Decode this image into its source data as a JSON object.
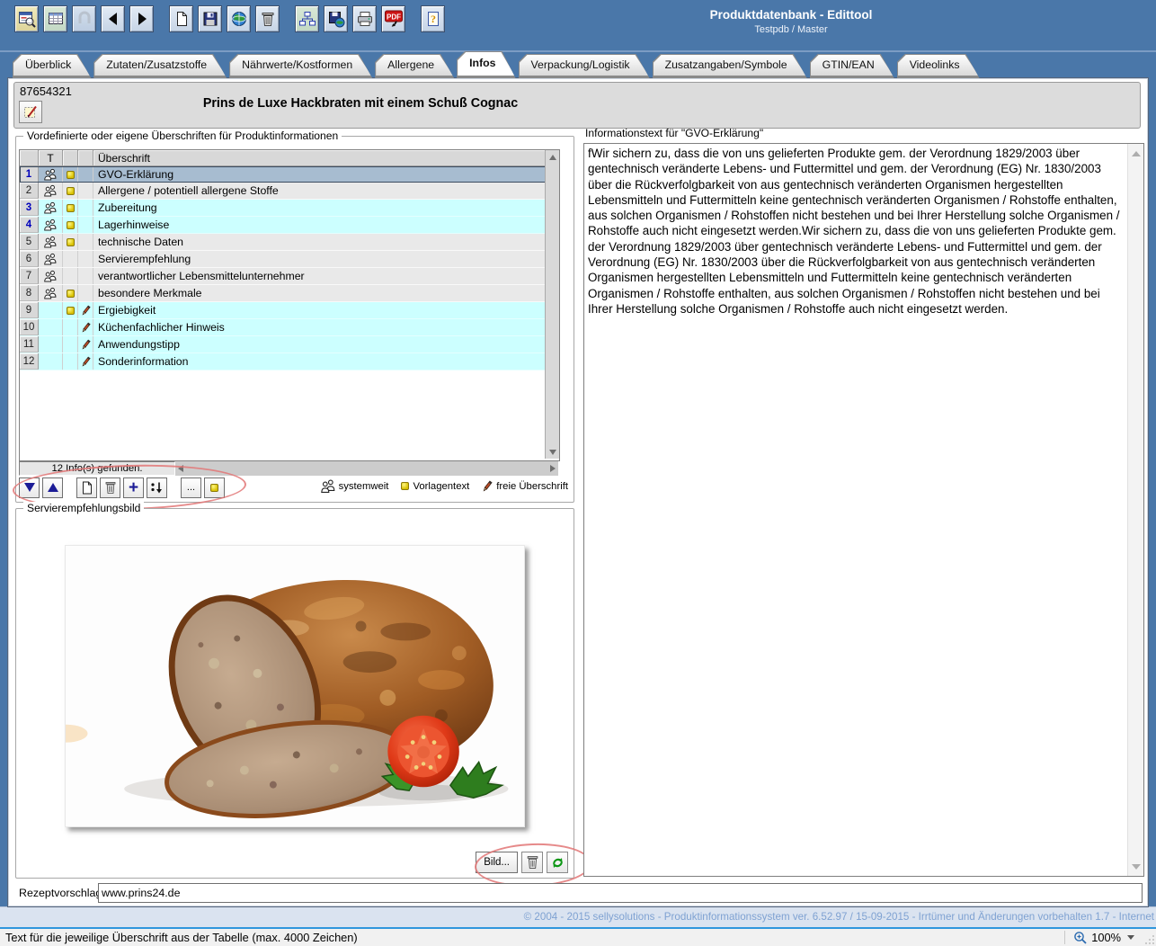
{
  "window": {
    "title": "Produktdatenbank - Edittool",
    "subtitle": "Testpdb / Master"
  },
  "toolbar": {
    "icons": [
      "search-form",
      "table-view",
      "disabled-action",
      "nav-back",
      "nav-forward",
      "new-record",
      "save",
      "web-globe",
      "delete",
      "structure",
      "save-web",
      "print",
      "pdf-export",
      "help"
    ]
  },
  "tabs": {
    "items": [
      {
        "label": "Überblick",
        "active": false
      },
      {
        "label": "Zutaten/Zusatzstoffe",
        "active": false
      },
      {
        "label": "Nährwerte/Kostformen",
        "active": false
      },
      {
        "label": "Allergene",
        "active": false
      },
      {
        "label": "Infos",
        "active": true
      },
      {
        "label": "Verpackung/Logistik",
        "active": false
      },
      {
        "label": "Zusatzangaben/Symbole",
        "active": false
      },
      {
        "label": "GTIN/EAN",
        "active": false
      },
      {
        "label": "Videolinks",
        "active": false
      }
    ]
  },
  "product": {
    "id": "87654321",
    "name": "Prins de Luxe Hackbraten mit einem Schuß Cognac"
  },
  "infoPanel": {
    "title": "Vordefinierte oder eigene Überschriften für Produktinformationen",
    "columns": {
      "t": "T",
      "heading": "Überschrift"
    },
    "rows": [
      {
        "nr": "1",
        "label": "GVO-Erklärung",
        "icons": [
          "systemweit",
          "vorlagentext"
        ],
        "state": "selected",
        "nrBlue": true
      },
      {
        "nr": "2",
        "label": "Allergene / potentiell allergene Stoffe",
        "icons": [
          "systemweit",
          "vorlagentext"
        ],
        "state": "gray",
        "nrBlue": false
      },
      {
        "nr": "3",
        "label": "Zubereitung",
        "icons": [
          "systemweit",
          "vorlagentext"
        ],
        "state": "cyan",
        "nrBlue": true
      },
      {
        "nr": "4",
        "label": "Lagerhinweise",
        "icons": [
          "systemweit",
          "vorlagentext"
        ],
        "state": "cyan",
        "nrBlue": true
      },
      {
        "nr": "5",
        "label": "technische Daten",
        "icons": [
          "systemweit",
          "vorlagentext"
        ],
        "state": "gray",
        "nrBlue": false
      },
      {
        "nr": "6",
        "label": "Servierempfehlung",
        "icons": [
          "systemweit"
        ],
        "state": "gray",
        "nrBlue": false
      },
      {
        "nr": "7",
        "label": "verantwortlicher Lebensmittelunternehmer",
        "icons": [
          "systemweit"
        ],
        "state": "gray",
        "nrBlue": false
      },
      {
        "nr": "8",
        "label": "besondere Merkmale",
        "icons": [
          "systemweit",
          "vorlagentext"
        ],
        "state": "gray",
        "nrBlue": false
      },
      {
        "nr": "9",
        "label": "Ergiebigkeit",
        "icons": [
          "vorlagentext",
          "frei"
        ],
        "state": "cyan",
        "nrBlue": false
      },
      {
        "nr": "10",
        "label": "Küchenfachlicher Hinweis",
        "icons": [
          "frei"
        ],
        "state": "cyan",
        "nrBlue": false
      },
      {
        "nr": "11",
        "label": "Anwendungstipp",
        "icons": [
          "frei"
        ],
        "state": "cyan",
        "nrBlue": false
      },
      {
        "nr": "12",
        "label": "Sonderinformation",
        "icons": [
          "frei"
        ],
        "state": "cyan",
        "nrBlue": false
      }
    ],
    "status": "12  Info(s) gefunden.",
    "actions": [
      "move-down",
      "move-up",
      "new-heading",
      "delete-heading",
      "add-heading",
      "sort-headings",
      "more-options",
      "vorlage-dot"
    ],
    "more_label": "...",
    "legend": [
      {
        "icon": "systemweit-icon",
        "label": "systemweit"
      },
      {
        "icon": "vorlagentext-icon",
        "label": "Vorlagentext"
      },
      {
        "icon": "freie-ueberschrift-icon",
        "label": "freie Überschrift"
      }
    ]
  },
  "infoText": {
    "title": "Informationstext für \"GVO-Erklärung\"",
    "content": "fWir sichern zu, dass die von uns gelieferten Produkte gem. der Verordnung 1829/2003 über gentechnisch veränderte Lebens- und Futtermittel und gem. der Verordnung (EG) Nr. 1830/2003 über die Rückverfolgbarkeit von aus gentechnisch veränderten Organismen hergestellten Lebensmitteln und Futtermitteln keine gentechnisch veränderten Organismen / Rohstoffe enthalten, aus solchen Organismen / Rohstoffen nicht bestehen und bei Ihrer Herstellung solche Organismen / Rohstoffe auch nicht eingesetzt werden.Wir sichern zu, dass die von uns gelieferten Produkte gem. der Verordnung 1829/2003 über gentechnisch veränderte Lebens- und Futtermittel und gem. der Verordnung (EG) Nr. 1830/2003 über die Rückverfolgbarkeit von aus gentechnisch veränderten Organismen hergestellten Lebensmitteln und Futtermitteln keine gentechnisch veränderten Organismen / Rohstoffe enthalten, aus solchen Organismen / Rohstoffen nicht bestehen und bei Ihrer Herstellung solche Organismen / Rohstoffe auch nicht eingesetzt werden."
  },
  "servingImage": {
    "title": "Servierempfehlungsbild",
    "buttons": {
      "bild": "Bild...",
      "delete_icon": "trash-icon",
      "refresh_icon": "refresh-icon"
    }
  },
  "recipe": {
    "label": "Rezeptvorschlag:",
    "value": "www.prins24.de"
  },
  "footer": {
    "copyright": "© 2004 - 2015 sellysolutions - Produktinformationssystem ver. 6.52.97 / 15-09-2015 - Irrtümer und Änderungen vorbehalten  1.7 - Internet"
  },
  "statusbar": {
    "hint": "Text für die jeweilige Überschrift aus der Tabelle (max. 4000 Zeichen)",
    "zoom": "100%"
  },
  "colors": {
    "titlebar": "#4a77a9",
    "row_cyan": "#ccffff",
    "row_selected": "#a7bcd0",
    "annotation_red": "#e27676",
    "footer_text": "#7fa2d2"
  }
}
